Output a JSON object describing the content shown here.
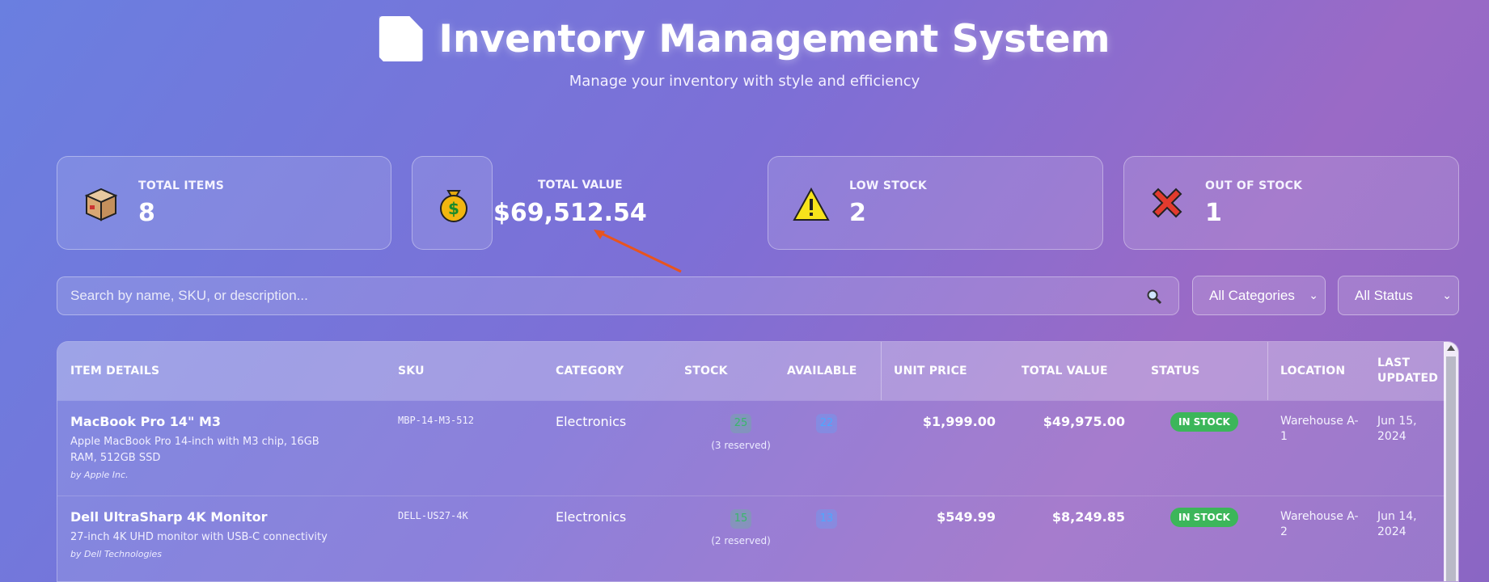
{
  "header": {
    "title": "Inventory Management System",
    "subtitle": "Manage your inventory with style and efficiency"
  },
  "stats": {
    "total_items": {
      "label": "TOTAL ITEMS",
      "value": "8",
      "icon": "package-icon"
    },
    "total_value": {
      "label": "TOTAL VALUE",
      "value": "$69,512.54",
      "icon": "money-bag-icon"
    },
    "low_stock": {
      "label": "LOW STOCK",
      "value": "2",
      "icon": "warning-icon"
    },
    "out_of_stock": {
      "label": "OUT OF STOCK",
      "value": "1",
      "icon": "cross-mark-icon"
    }
  },
  "filters": {
    "search_placeholder": "Search by name, SKU, or description...",
    "category": "All Categories",
    "status": "All Status"
  },
  "table": {
    "columns": [
      "ITEM DETAILS",
      "SKU",
      "CATEGORY",
      "STOCK",
      "AVAILABLE",
      "UNIT PRICE",
      "TOTAL VALUE",
      "STATUS",
      "LOCATION",
      "LAST",
      "UPDATED"
    ],
    "rows": [
      {
        "name": "MacBook Pro 14\" M3",
        "description": "Apple MacBook Pro 14-inch with M3 chip, 16GB RAM, 512GB SSD",
        "maker": "by Apple Inc.",
        "sku": "MBP-14-M3-512",
        "category": "Electronics",
        "stock": "25",
        "reserved": "(3 reserved)",
        "available": "22",
        "unit_price": "$1,999.00",
        "total_value": "$49,975.00",
        "status": "IN STOCK",
        "location_1": "Warehouse A-",
        "location_2": "1",
        "date_1": "Jun 15,",
        "date_2": "2024"
      },
      {
        "name": "Dell UltraSharp 4K Monitor",
        "description": "27-inch 4K UHD monitor with USB-C connectivity",
        "maker": "by Dell Technologies",
        "sku": "DELL-US27-4K",
        "category": "Electronics",
        "stock": "15",
        "reserved": "(2 reserved)",
        "available": "13",
        "unit_price": "$549.99",
        "total_value": "$8,249.85",
        "status": "IN STOCK",
        "location_1": "Warehouse A-",
        "location_2": "2",
        "date_1": "Jun 14,",
        "date_2": "2024"
      }
    ]
  },
  "colors": {
    "in_stock": "#3cb65a",
    "arrow": "#e8541e"
  }
}
